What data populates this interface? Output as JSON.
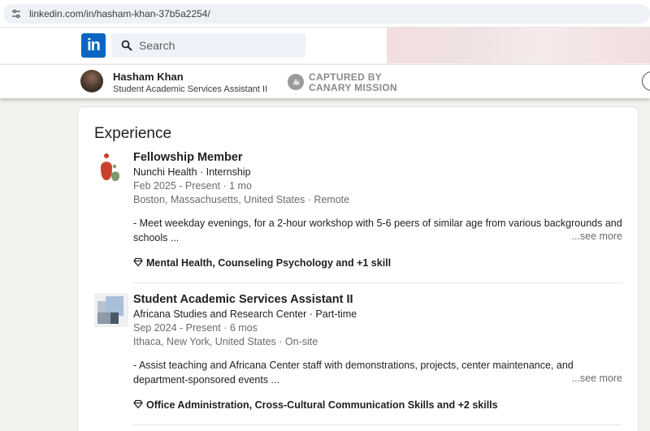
{
  "browser": {
    "url": "linkedin.com/in/hasham-khan-37b5a2254/",
    "site_info_icon": "tune-icon"
  },
  "header": {
    "logo_text": "in",
    "search_placeholder": "Search",
    "brand_color": "#0a66c2"
  },
  "profile_bar": {
    "name": "Hasham Khan",
    "headline": "Student Academic Services Assistant II",
    "captured_line1": "CAPTURED BY",
    "captured_line2": "CANARY MISSION"
  },
  "experience": {
    "section_title": "Experience",
    "items": [
      {
        "title": "Fellowship Member",
        "company": "Nunchi Health · Internship",
        "dates": "Feb 2025 - Present · 1 mo",
        "location": "Boston, Massachusetts, United States · Remote",
        "description": "- Meet weekday evenings, for a 2-hour workshop with 5-6 peers of similar age from various backgrounds and schools ...",
        "see_more": "...see more",
        "skills": "Mental Health, Counseling Psychology and +1 skill"
      },
      {
        "title": "Student Academic Services Assistant II",
        "company": "Africana Studies and Research Center · Part-time",
        "dates": "Sep 2024 - Present · 6 mos",
        "location": "Ithaca, New York, United States · On-site",
        "description": "- Assist teaching and Africana Center staff with demonstrations, projects, center maintenance, and department-sponsored events ...",
        "see_more": "...see more",
        "skills": "Office Administration, Cross-Cultural Communication Skills and +2 skills"
      }
    ]
  }
}
